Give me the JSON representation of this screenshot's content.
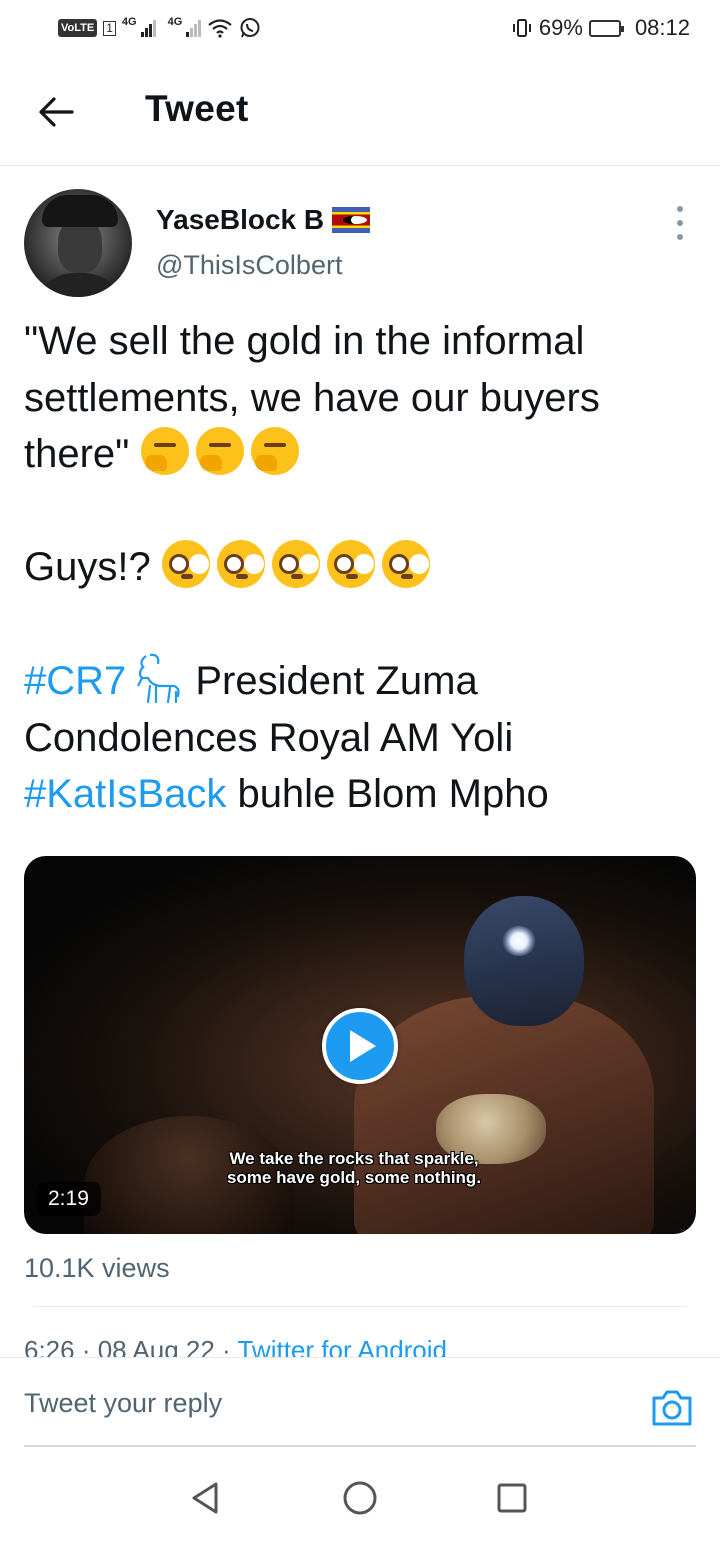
{
  "status_bar": {
    "volte": "VoLTE",
    "sim": "1",
    "net1": "4G",
    "net2": "4G",
    "battery_percent": "69%",
    "battery_level": 0.69,
    "time": "08:12"
  },
  "header": {
    "title": "Tweet"
  },
  "tweet": {
    "display_name": "YaseBlock B",
    "handle": "@ThisIsColbert",
    "quote": "\"We sell the gold in the informal settlements, we have our buyers there\"",
    "guys": "Guys!?",
    "hashtag1": "#CR7",
    "line3_rest": " President Zuma Condolences Royal AM Yoli",
    "hashtag2": "#KatIsBack",
    "line4_rest": " buhle Blom Mpho",
    "video": {
      "subtitle_line1": "We take the rocks that sparkle,",
      "subtitle_line2": "some have gold, some nothing.",
      "duration": "2:19"
    },
    "views": "10.1K views",
    "time": "6:26 · 08 Aug 22 · ",
    "source": "Twitter for Android"
  },
  "reply": {
    "placeholder": "Tweet your reply"
  },
  "icons": {
    "back": "arrow-left-icon",
    "more": "more-vertical-icon",
    "play": "play-icon",
    "camera": "camera-icon"
  },
  "colors": {
    "accent": "#1d9bf0",
    "text": "#0f1419",
    "secondary": "#536471"
  }
}
